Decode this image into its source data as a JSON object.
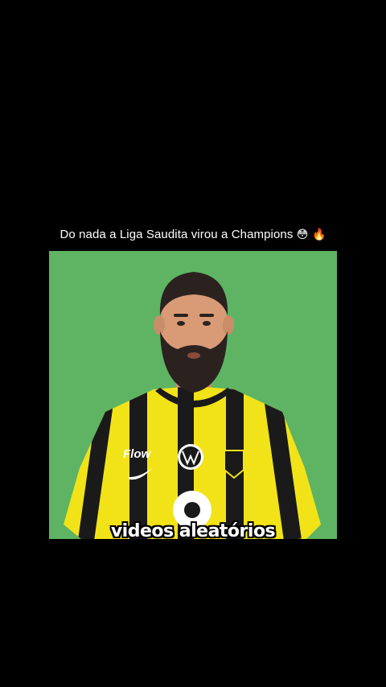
{
  "post": {
    "caption": "Do nada a Liga Saudita virou a Champions",
    "caption_emojis": "😳 🔥"
  },
  "video": {
    "background_color": "#5eb463",
    "jersey_colors": [
      "#f2e318",
      "#1a1a1a"
    ],
    "sponsor_text": "Flow",
    "watermark": "videos aleatórios"
  }
}
